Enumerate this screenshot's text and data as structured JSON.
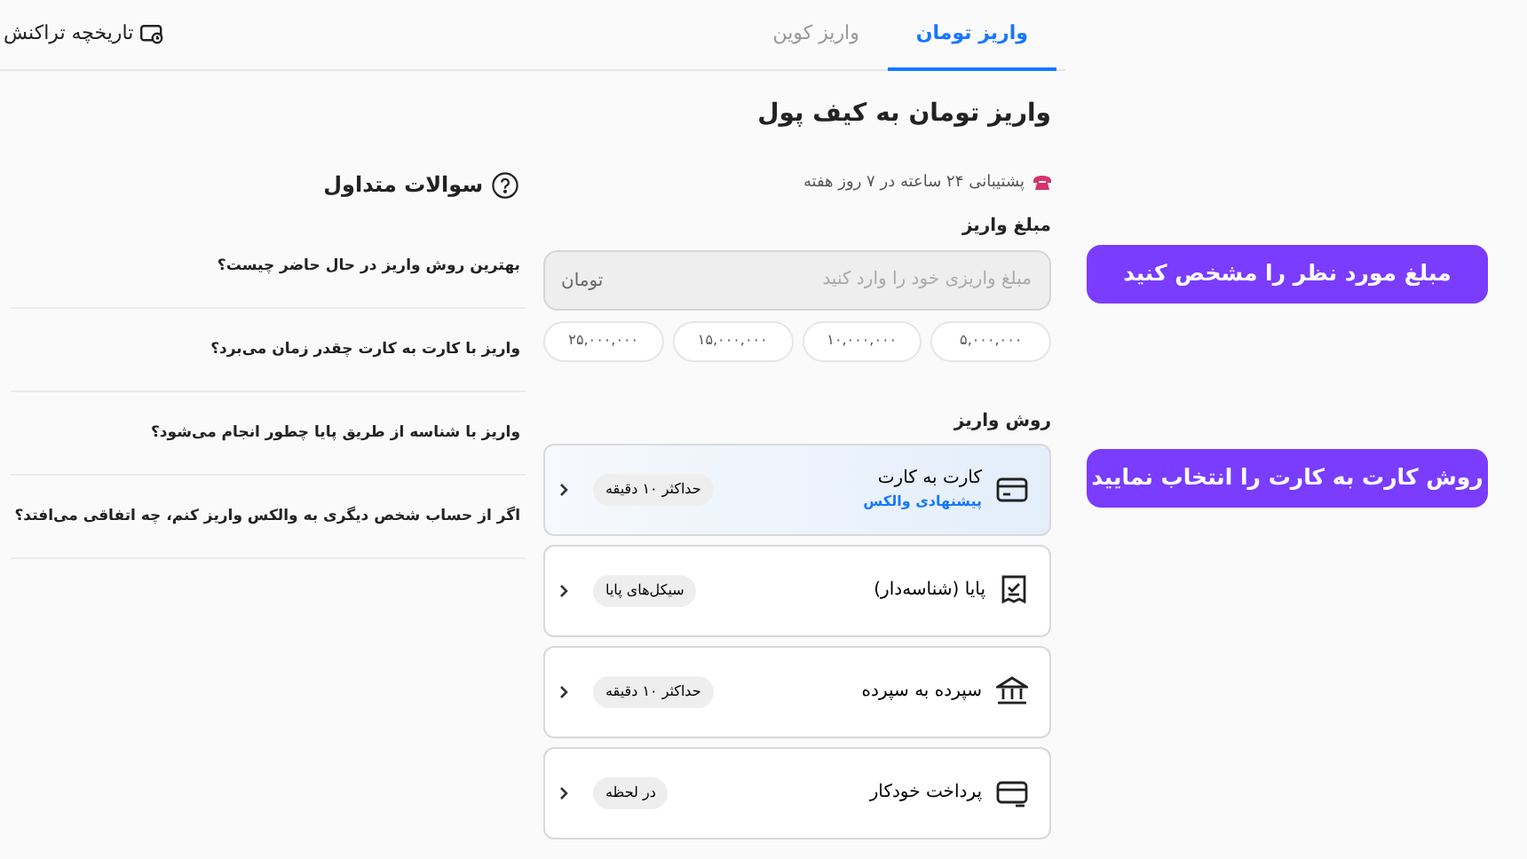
{
  "header": {
    "history_link": "تاریخچه تراکنش",
    "tabs": [
      {
        "label": "واریز تومان",
        "selected": true
      },
      {
        "label": "واریز کوین",
        "selected": false
      }
    ]
  },
  "title": "واریز تومان به کیف پول",
  "support": "پشتیبانی ۲۴ ساعته در ۷ روز هفته",
  "amount": {
    "label": "مبلغ واریز",
    "placeholder": "مبلغ واریزی خود را وارد کنید",
    "unit": "تومان",
    "presets": [
      "۵,۰۰۰,۰۰۰",
      "۱۰,۰۰۰,۰۰۰",
      "۱۵,۰۰۰,۰۰۰",
      "۲۵,۰۰۰,۰۰۰"
    ]
  },
  "methods": {
    "label": "روش واریز",
    "items": [
      {
        "kind": "card",
        "name": "کارت به کارت",
        "note": "پیشنهادی والکس",
        "badge": "حداکثر ۱۰ دقیقه",
        "selected": true
      },
      {
        "kind": "paya",
        "name": "پایا (شناسه‌دار)",
        "badge": "سیکل‌های پایا",
        "selected": false
      },
      {
        "kind": "bank",
        "name": "سپرده به سپرده",
        "badge": "حداکثر ۱۰ دقیقه",
        "selected": false
      },
      {
        "kind": "auto",
        "name": "پرداخت خودکار",
        "badge": "در لحظه",
        "selected": false
      }
    ]
  },
  "faq": {
    "title": "سوالات متداول",
    "items": [
      "بهترین روش واریز در حال حاضر چیست؟",
      "واریز با کارت به کارت چقدر زمان می‌برد؟",
      "واریز با شناسه از طریق پایا چطور انجام می‌شود؟",
      "اگر از حساب شخص دیگری به والکس واریز کنم، چه اتفاقی می‌افتد؟"
    ]
  },
  "callouts": [
    "مبلغ مورد نظر را مشخص کنید",
    "روش کارت به کارت را انتخاب نمایید"
  ]
}
